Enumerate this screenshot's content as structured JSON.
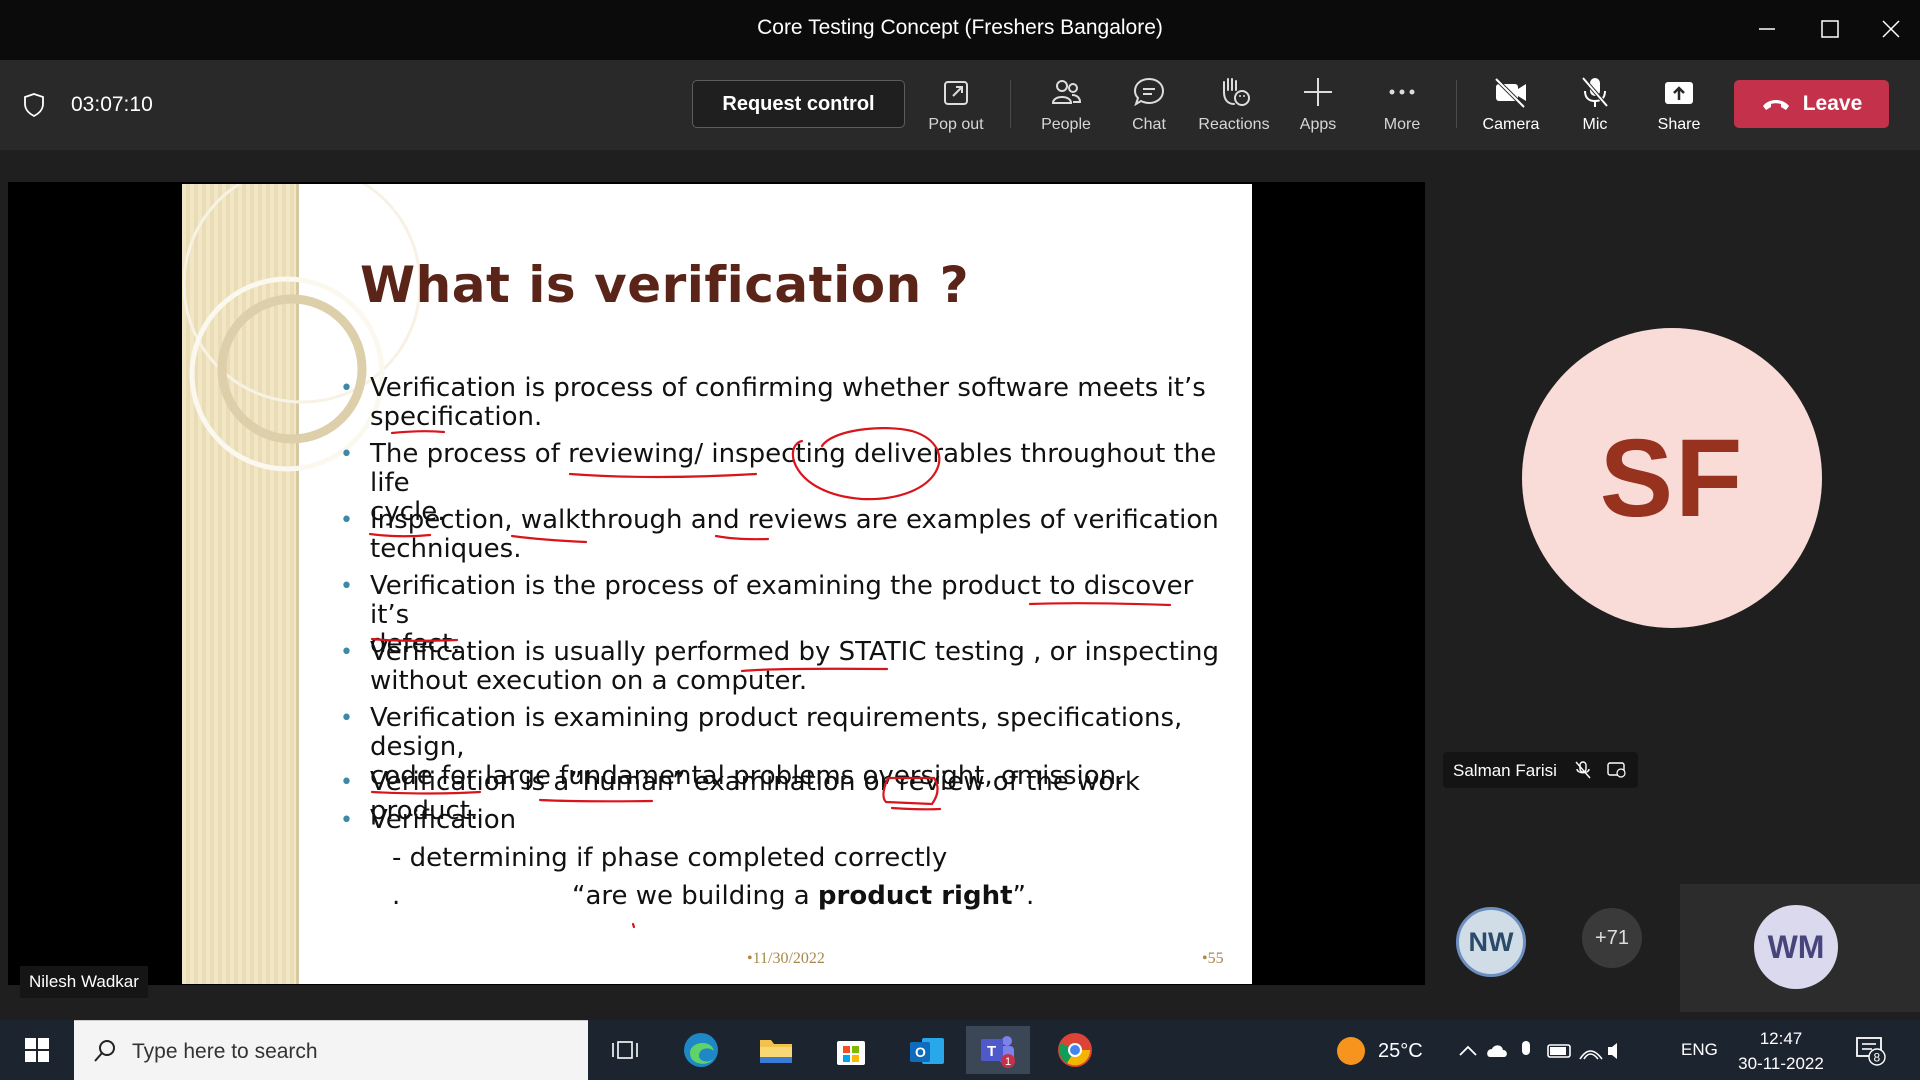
{
  "window": {
    "title": "Core Testing Concept (Freshers Bangalore)"
  },
  "toolbar": {
    "timer": "03:07:10",
    "request_control": "Request control",
    "buttons": {
      "popout": "Pop out",
      "people": "People",
      "chat": "Chat",
      "reactions": "Reactions",
      "apps": "Apps",
      "more": "More",
      "camera": "Camera",
      "mic": "Mic",
      "share": "Share"
    },
    "leave": "Leave",
    "leave_color": "#c4314b"
  },
  "slide": {
    "title": "What is verification ?",
    "bullets": [
      {
        "l1": "Verification is process of confirming whether software meets it’s",
        "l2": "specification."
      },
      {
        "l1": "The process of reviewing/ inspecting deliverables throughout the life",
        "l2": "cycle."
      },
      {
        "l1": "Inspection, walkthrough and reviews are examples of verification",
        "l2": "techniques."
      },
      {
        "l1": "Verification is the process of examining the product to discover it’s",
        "l2": "defect."
      },
      {
        "l1": "Verification is usually performed by STATIC testing , or inspecting",
        "l2": "without execution on a computer."
      },
      {
        "l1": "Verification is examining product requirements, specifications, design,",
        "l2": "code for large fundamental problems oversight, omission."
      },
      {
        "l1": "Verification is a”human” examination or review of the work product.",
        "l2": ""
      },
      {
        "l1": "Verification",
        "l2": ""
      }
    ],
    "sub1": "-  determining if phase completed correctly",
    "sub2_dot": ".",
    "sub2_pre": "“are we building a ",
    "sub2_bold": "product right",
    "sub2_post": "”.",
    "footer_date": "•11/30/2022",
    "footer_page": "•55",
    "ink_color": "#d8151b"
  },
  "presenter_name": "Nilesh Wadkar",
  "participants": {
    "main": {
      "initials": "SF",
      "name": "Salman Farisi"
    },
    "thumbs": [
      {
        "initials": "NW"
      },
      {
        "initials": "+71"
      },
      {
        "initials": "WM"
      }
    ]
  },
  "taskbar": {
    "search_placeholder": "Type here to search",
    "temperature": "25°C",
    "language": "ENG",
    "time": "12:47",
    "date": "30-11-2022",
    "notifications": "8",
    "teams_badge": "1"
  }
}
